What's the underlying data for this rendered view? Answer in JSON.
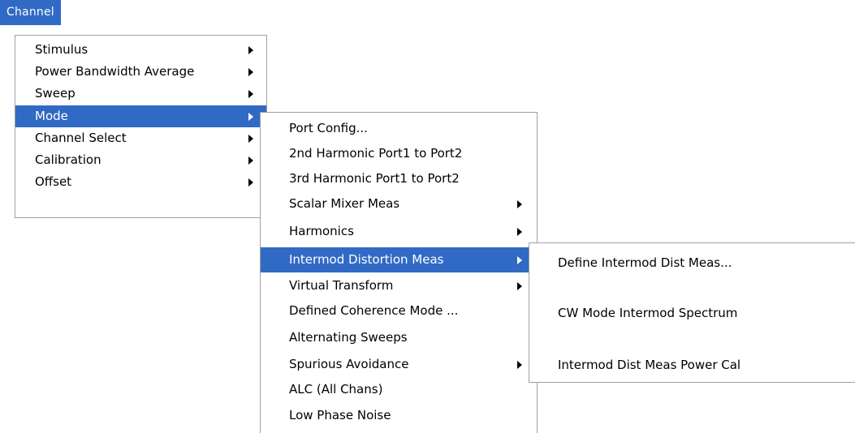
{
  "menubar": {
    "channel_label": "Channel"
  },
  "colors": {
    "highlight": "#316ac5",
    "menu_border": "#a0a0a0",
    "menu_bg": "#ffffff"
  },
  "main_menu": {
    "items": [
      {
        "label": "Stimulus",
        "has_submenu": true
      },
      {
        "label": "Power Bandwidth Average",
        "has_submenu": true
      },
      {
        "label": "Sweep",
        "has_submenu": true
      },
      {
        "label": "Mode",
        "has_submenu": true,
        "selected": true
      },
      {
        "label": "Channel Select",
        "has_submenu": true
      },
      {
        "label": "Calibration",
        "has_submenu": true
      },
      {
        "label": "Offset",
        "has_submenu": true
      }
    ]
  },
  "mode_menu": {
    "items": [
      {
        "label": "Port Config...",
        "has_submenu": false
      },
      {
        "label": "2nd Harmonic Port1 to Port2",
        "has_submenu": false
      },
      {
        "label": "3rd Harmonic Port1 to Port2",
        "has_submenu": false
      },
      {
        "label": "Scalar Mixer Meas",
        "has_submenu": true
      },
      {
        "label": "Harmonics",
        "has_submenu": true
      },
      {
        "label": "Intermod Distortion Meas",
        "has_submenu": true,
        "selected": true
      },
      {
        "label": "Virtual Transform",
        "has_submenu": true
      },
      {
        "label": "Defined Coherence Mode ...",
        "has_submenu": false
      },
      {
        "label": "Alternating Sweeps",
        "has_submenu": false
      },
      {
        "label": "Spurious Avoidance",
        "has_submenu": true
      },
      {
        "label": "ALC (All Chans)",
        "has_submenu": false
      },
      {
        "label": "Low Phase Noise",
        "has_submenu": false
      }
    ]
  },
  "intermod_menu": {
    "items": [
      {
        "label": "Define Intermod Dist Meas...",
        "has_submenu": false
      },
      {
        "label": "CW Mode Intermod Spectrum",
        "has_submenu": false
      },
      {
        "label": "Intermod Dist Meas Power Cal",
        "has_submenu": false
      }
    ]
  }
}
